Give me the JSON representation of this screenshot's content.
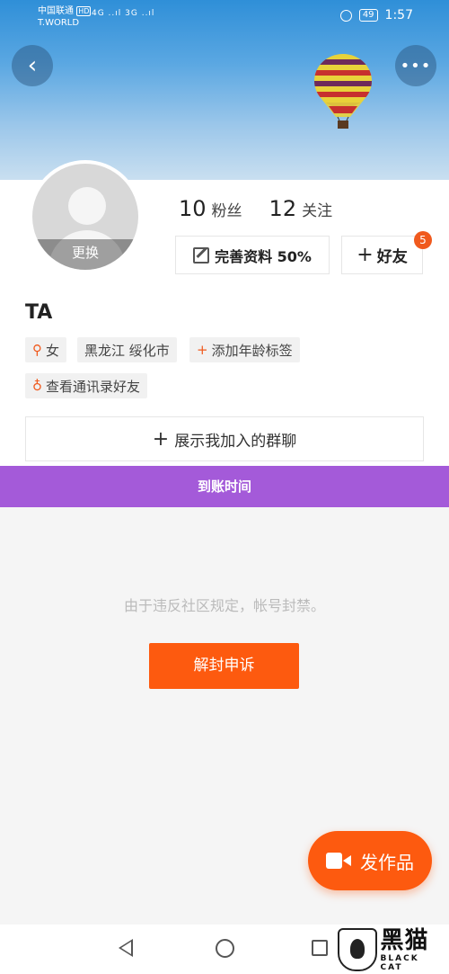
{
  "status_bar": {
    "carrier": "中国联通",
    "carrier_hd": "HD",
    "carrier_sub": "T.WORLD",
    "signals": "4G ..ıl 3G ..ıl",
    "battery": "49",
    "time": "1:57"
  },
  "header": {
    "back_icon": "chevron-left-icon",
    "more_icon": "more-dots-icon",
    "more_text": "•••",
    "back_text": "‹"
  },
  "profile": {
    "avatar_change_label": "更换",
    "fans_count": "10",
    "fans_label": "粉丝",
    "following_count": "12",
    "following_label": "关注",
    "complete_profile_label": "完善资料 50%",
    "add_friend_label": "好友",
    "friend_badge": "5",
    "name": "TA",
    "tags": {
      "gender": "女",
      "location": "黑龙江 绥化市",
      "add_age": "添加年龄标签",
      "contacts": "查看通讯录好友"
    },
    "show_groups_label": "展示我加入的群聊"
  },
  "banner_bar": {
    "text": "到账时间",
    "color": "#a45ad9"
  },
  "ban": {
    "message": "由于违反社区规定，帐号封禁。",
    "appeal_label": "解封申诉"
  },
  "publish": {
    "label": "发作品"
  },
  "watermark": {
    "cn": "黑猫",
    "en": "BLACK CAT"
  },
  "colors": {
    "accent": "#fd5a0f",
    "purple": "#a45ad9"
  }
}
